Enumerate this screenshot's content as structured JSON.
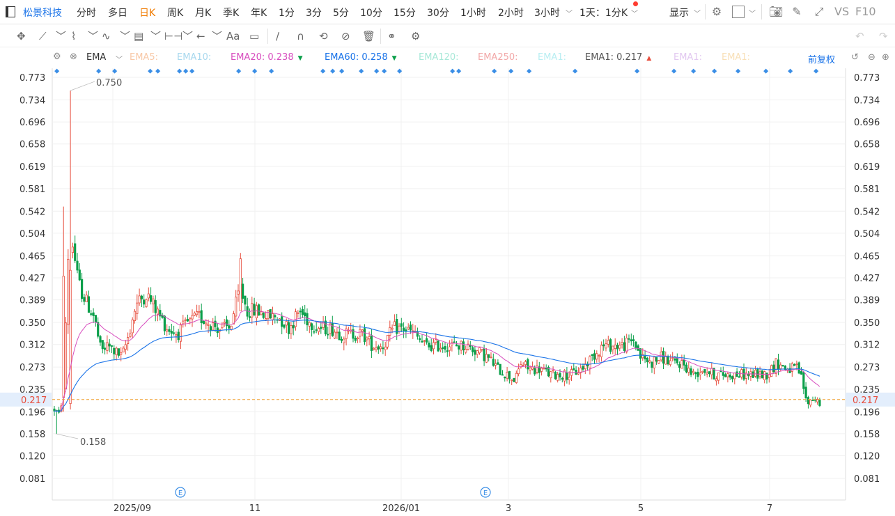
{
  "stock": {
    "name": "松景科技"
  },
  "timeframes": [
    {
      "label": "分时",
      "active": false
    },
    {
      "label": "多日",
      "active": false
    },
    {
      "label": "日K",
      "active": true
    },
    {
      "label": "周K",
      "active": false
    },
    {
      "label": "月K",
      "active": false
    },
    {
      "label": "季K",
      "active": false
    },
    {
      "label": "年K",
      "active": false
    },
    {
      "label": "1分",
      "active": false
    },
    {
      "label": "3分",
      "active": false
    },
    {
      "label": "5分",
      "active": false
    },
    {
      "label": "10分",
      "active": false
    },
    {
      "label": "15分",
      "active": false
    },
    {
      "label": "30分",
      "active": false
    },
    {
      "label": "1小时",
      "active": false
    },
    {
      "label": "2小时",
      "active": false
    },
    {
      "label": "3小时",
      "active": false
    },
    {
      "label": "1天：1分K",
      "active": false
    }
  ],
  "topbar": {
    "display_label": "显示",
    "vs_label": "VS",
    "f10_label": "F10"
  },
  "indicator": {
    "name": "EMA",
    "fq_label": "前复权",
    "lines": [
      {
        "label": "EMA5:",
        "value": "",
        "color": "#f8c9a8",
        "arrow": ""
      },
      {
        "label": "EMA10:",
        "value": "",
        "color": "#a8d8ee",
        "arrow": ""
      },
      {
        "label": "EMA20:",
        "value": "0.238",
        "color": "#d84fbf",
        "arrow": "down"
      },
      {
        "label": "EMA60:",
        "value": "0.258",
        "color": "#1a73e8",
        "arrow": "down"
      },
      {
        "label": "EMA120:",
        "value": "",
        "color": "#a8e8d8",
        "arrow": ""
      },
      {
        "label": "EMA250:",
        "value": "",
        "color": "#f2a8a8",
        "arrow": ""
      },
      {
        "label": "EMA1:",
        "value": "",
        "color": "#b8eef2",
        "arrow": ""
      },
      {
        "label": "EMA1:",
        "value": "0.217",
        "color": "#555555",
        "arrow": "up"
      },
      {
        "label": "EMA1:",
        "value": "",
        "color": "#e2c8f0",
        "arrow": ""
      },
      {
        "label": "EMA1:",
        "value": "",
        "color": "#f8e0b8",
        "arrow": ""
      }
    ]
  },
  "chart_data": {
    "type": "candlestick",
    "y_ticks": [
      "0.773",
      "0.734",
      "0.696",
      "0.658",
      "0.619",
      "0.581",
      "0.542",
      "0.504",
      "0.465",
      "0.427",
      "0.389",
      "0.350",
      "0.312",
      "0.273",
      "0.235",
      "0.196",
      "0.158",
      "0.120",
      "0.081"
    ],
    "x_labels": [
      "2025/09",
      "11",
      "2026/01",
      "3",
      "5",
      "7"
    ],
    "current_price": "0.217",
    "max_label": "0.750",
    "min_label": "0.158",
    "event_markers": [
      "E",
      "E"
    ],
    "colors": {
      "up": "#e74c3c",
      "down": "#0b9f4a",
      "ema20": "#d84fbf",
      "ema60": "#1a73e8",
      "price_line": "#f0a030"
    }
  }
}
